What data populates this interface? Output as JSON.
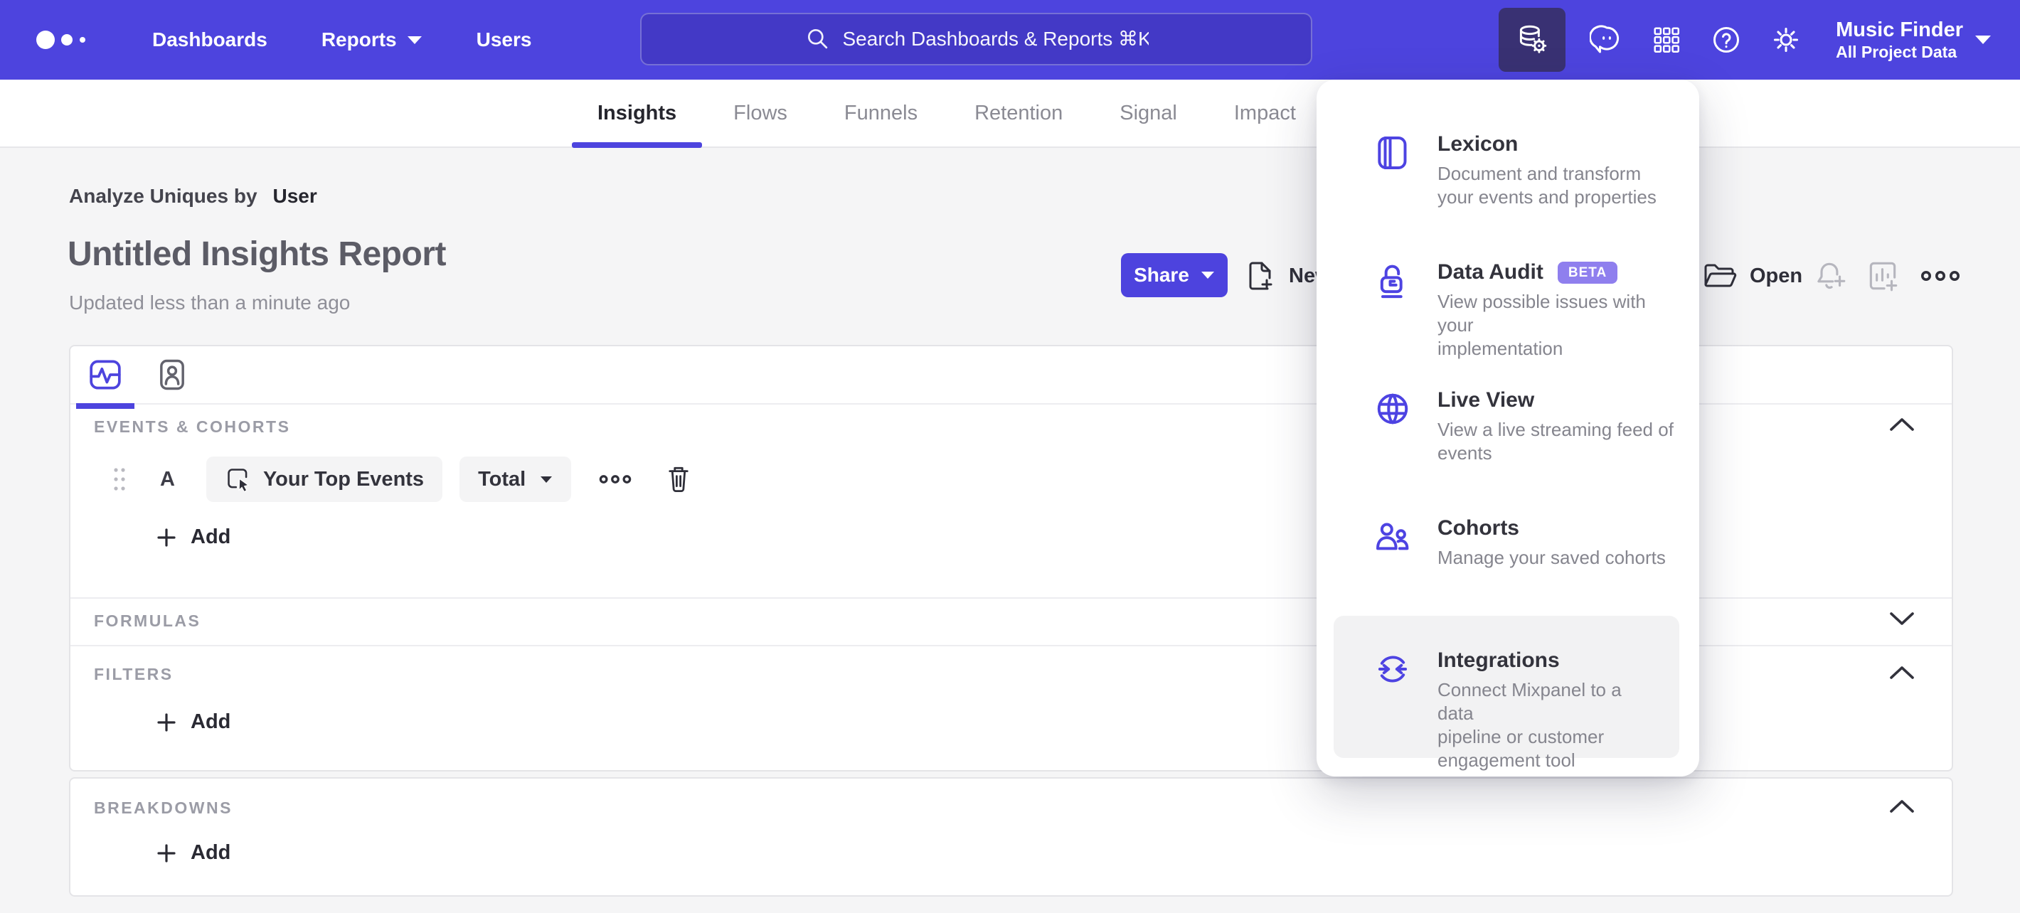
{
  "nav": {
    "items": [
      {
        "label": "Dashboards"
      },
      {
        "label": "Reports"
      },
      {
        "label": "Users"
      }
    ],
    "search": {
      "placeholder": "Search Dashboards & Reports ⌘K"
    },
    "project": {
      "name": "Music Finder",
      "scope": "All Project Data"
    }
  },
  "tabs": {
    "items": [
      "Insights",
      "Flows",
      "Funnels",
      "Retention",
      "Signal",
      "Impact"
    ],
    "active": "Insights"
  },
  "report": {
    "analyze_label": "Analyze Uniques by",
    "analyze_value": "User",
    "title": "Untitled Insights Report",
    "updated": "Updated less than a minute ago",
    "toolbar": {
      "share_label": "Share",
      "new_label": "New",
      "open_label": "Open"
    }
  },
  "builder": {
    "events_label": "EVENTS & COHORTS",
    "row": {
      "series_letter": "A",
      "event_name": "Your Top Events",
      "metric": "Total"
    },
    "add_label": "Add",
    "formulas_label": "FORMULAS",
    "filters_label": "FILTERS",
    "breakdowns_label": "BREAKDOWNS"
  },
  "menu": {
    "items": [
      {
        "title": "Lexicon",
        "icon": "book-icon",
        "desc_lines": [
          "Document and transform",
          "your events and properties"
        ]
      },
      {
        "title": "Data Audit",
        "icon": "open-lock-icon",
        "badge": "BETA",
        "desc_lines": [
          "View possible issues with your",
          "implementation"
        ]
      },
      {
        "title": "Live View",
        "icon": "globe-icon",
        "desc_lines": [
          "View a live streaming feed of",
          "events"
        ]
      },
      {
        "title": "Cohorts",
        "icon": "people-icon",
        "desc_lines": [
          "Manage your saved cohorts"
        ]
      },
      {
        "title": "Integrations",
        "icon": "sync-arrows-icon",
        "highlighted": true,
        "desc_lines": [
          "Connect Mixpanel to a data",
          "pipeline or customer",
          "engagement tool"
        ]
      }
    ]
  },
  "icons": {
    "logo": "mixpanel-three-dots",
    "search": "magnifier",
    "data-management": "database-gear",
    "feedback": "speech-bubble-face",
    "apps": "grid-3x3",
    "help": "question-circle",
    "settings": "gear",
    "new": "document-plus",
    "open": "open-folder",
    "alert": "bell-plus",
    "board": "chart-plus",
    "more": "three-dots",
    "events-tab": "pulse-chart-card",
    "profiles-tab": "person-card",
    "drag": "drag-dots",
    "event-picker": "cursor-select",
    "delete": "trash",
    "carets": "chevron-up / chevron-down"
  },
  "colors": {
    "nav_purple": "#4D44DE",
    "active_tile": "#393173",
    "accent": "#4D44DE",
    "beta_badge": "#8F7FEE",
    "page_bg": "#f5f5f6",
    "menu_highlight": "#f2f2f3"
  }
}
